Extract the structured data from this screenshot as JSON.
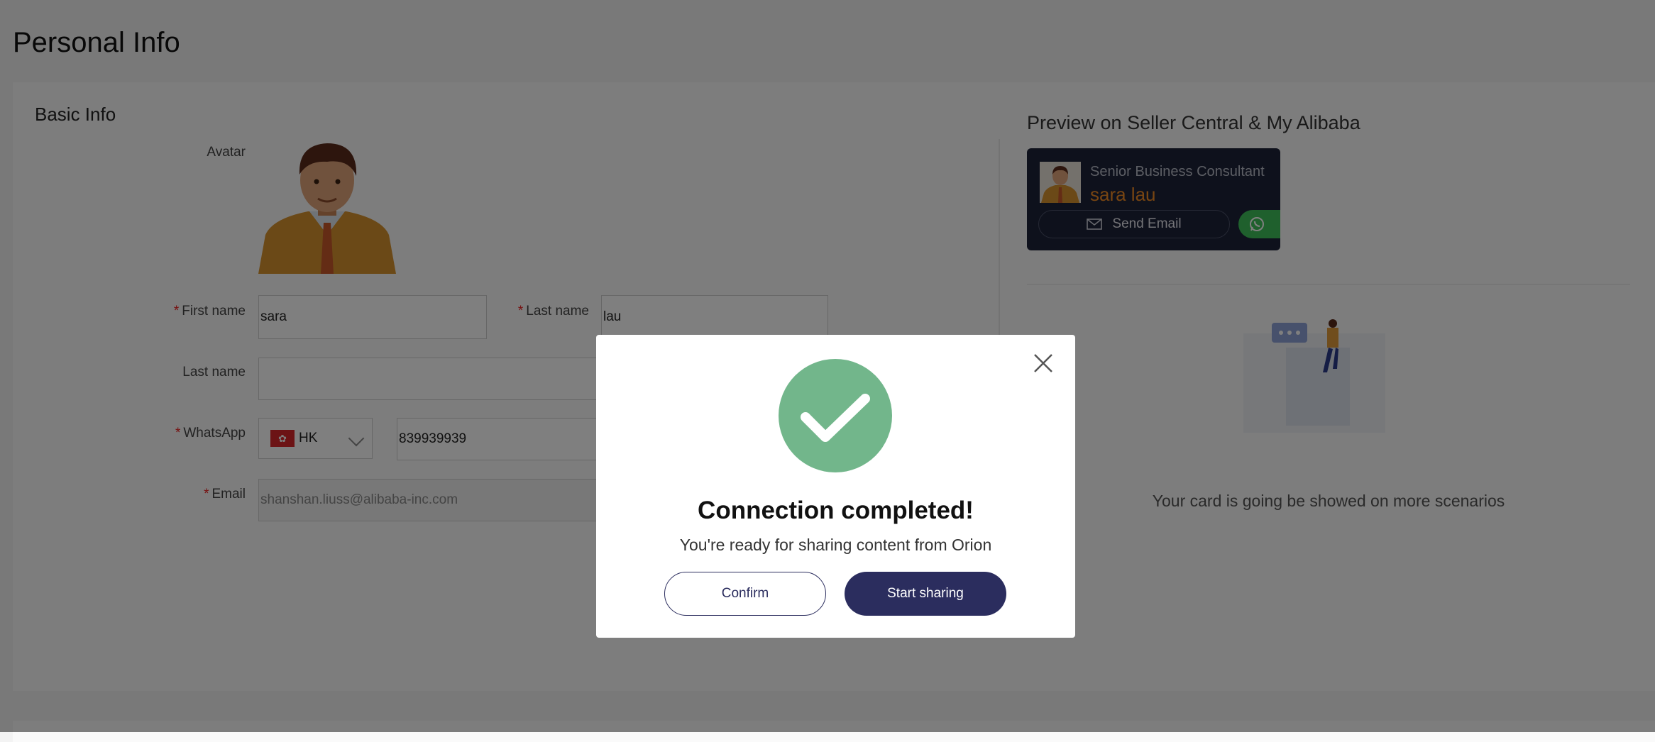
{
  "page": {
    "title": "Personal Info"
  },
  "basic_info": {
    "section_title": "Basic Info",
    "avatar_label": "Avatar",
    "first_name_label": "First name",
    "first_name_value": "sara",
    "last_name_label": "Last name",
    "last_name_value": "lau",
    "last_name_local_label": "Last name",
    "last_name_local_value": "",
    "whatsapp_label": "WhatsApp",
    "country_code": "HK",
    "whatsapp_number": "839939939",
    "email_label": "Email",
    "email_value": "shanshan.liuss@alibaba-inc.com",
    "required_mark": "*"
  },
  "preview": {
    "title": "Preview on Seller Central & My Alibaba",
    "card_role": "Senior Business Consultant",
    "card_name": "sara lau",
    "send_email_label": "Send Email",
    "caption": "Your card is going be showed on more scenarios"
  },
  "modal": {
    "title": "Connection completed!",
    "subtitle": "You're ready for sharing content from Orion",
    "confirm_label": "Confirm",
    "start_label": "Start sharing"
  },
  "colors": {
    "accent": "#2b2d5e",
    "success": "#72b68b",
    "card_name": "#f08a24",
    "whatsapp": "#3ec15a",
    "required": "#e22222"
  }
}
